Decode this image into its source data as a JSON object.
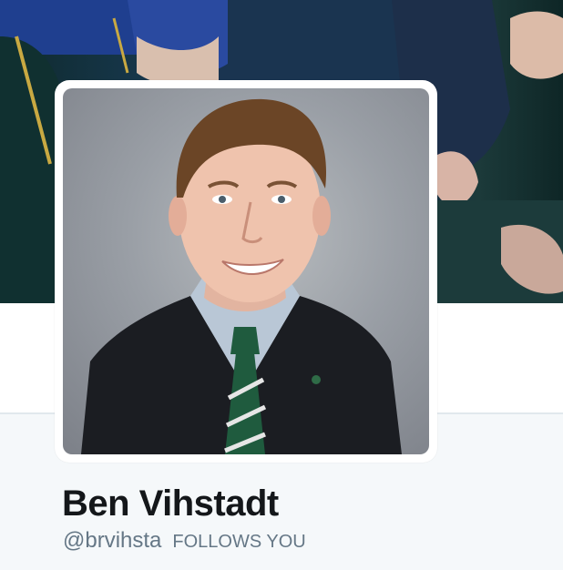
{
  "profile": {
    "name": "Ben Vihstadt",
    "handle": "@brvihsta",
    "follows_you_label": "FOLLOWS YOU"
  },
  "colors": {
    "name_text": "#14171a",
    "secondary_text": "#657786",
    "page_background": "#f5f8fa",
    "card_background": "#ffffff",
    "divider": "#e1e8ed"
  }
}
